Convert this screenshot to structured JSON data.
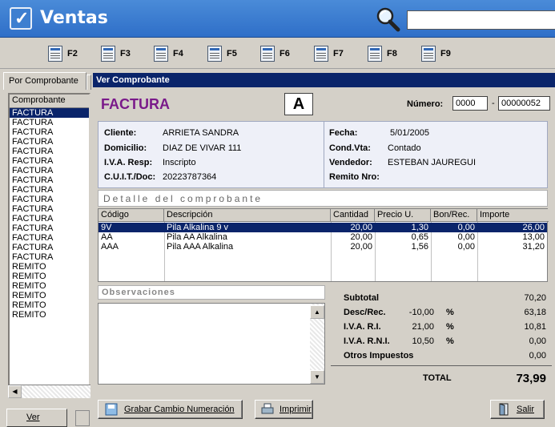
{
  "app": {
    "title": "Ventas",
    "search_value": ""
  },
  "fkeys": [
    "F2",
    "F3",
    "F4",
    "F5",
    "F6",
    "F7",
    "F8",
    "F9"
  ],
  "left": {
    "tab_label": "Por Comprobante",
    "list_header": "Comprobante",
    "items": [
      "FACTURA",
      "FACTURA",
      "FACTURA",
      "FACTURA",
      "FACTURA",
      "FACTURA",
      "FACTURA",
      "FACTURA",
      "FACTURA",
      "FACTURA",
      "FACTURA",
      "FACTURA",
      "FACTURA",
      "FACTURA",
      "FACTURA",
      "FACTURA",
      "REMITO",
      "REMITO",
      "REMITO",
      "REMITO",
      "REMITO",
      "REMITO"
    ],
    "ver_label": "Ver"
  },
  "main": {
    "header": "Ver Comprobante",
    "doc_type": "FACTURA",
    "letter": "A",
    "numero_label": "Número:",
    "numero_1": "0000",
    "numero_dash": "-",
    "numero_2": "00000052",
    "info": {
      "cliente_label": "Cliente:",
      "cliente": "ARRIETA SANDRA",
      "domicilio_label": "Domicilio:",
      "domicilio": "DIAZ DE VIVAR 111",
      "iva_label": "I.V.A. Resp:",
      "iva": "Inscripto",
      "cuit_label": "C.U.I.T./Doc:",
      "cuit": "20223787364",
      "fecha_label": "Fecha:",
      "fecha": "5/01/2005",
      "condvta_label": "Cond.Vta:",
      "condvta": "Contado",
      "vendedor_label": "Vendedor:",
      "vendedor": "ESTEBAN JAUREGUI",
      "remito_label": "Remito Nro:",
      "remito": ""
    },
    "detalle_title": "Detalle del comprobante",
    "table": {
      "headers": [
        "Código",
        "Descripción",
        "Cantidad",
        "Precio U.",
        "Bon/Rec.",
        "Importe"
      ],
      "rows": [
        [
          "9V",
          "Pila Alkalina 9 v",
          "20,00",
          "1,30",
          "0,00",
          "26,00"
        ],
        [
          "AA",
          "Pila AA Alkalina",
          "20,00",
          "0,65",
          "0,00",
          "13,00"
        ],
        [
          "AAA",
          "Pila AAA Alkalina",
          "20,00",
          "1,56",
          "0,00",
          "31,20"
        ]
      ]
    },
    "observaciones_label": "Observaciones",
    "observaciones": "",
    "totals": {
      "subtotal_label": "Subtotal",
      "subtotal": "70,20",
      "desc_label": "Desc/Rec.",
      "desc_pct": "-10,00",
      "desc_unit": "%",
      "desc": "63,18",
      "ivari_label": "I.V.A. R.I.",
      "ivari_pct": "21,00",
      "ivari_unit": "%",
      "ivari": "10,81",
      "ivarni_label": "I.V.A. R.N.I.",
      "ivarni_pct": "10,50",
      "ivarni_unit": "%",
      "ivarni": "0,00",
      "otros_label": "Otros Impuestos",
      "otros": "0,00",
      "total_label": "TOTAL",
      "total": "73,99"
    },
    "buttons": {
      "grabar": "Grabar Cambio Numeración",
      "imprimir": "Imprimir",
      "salir": "Salir"
    }
  }
}
